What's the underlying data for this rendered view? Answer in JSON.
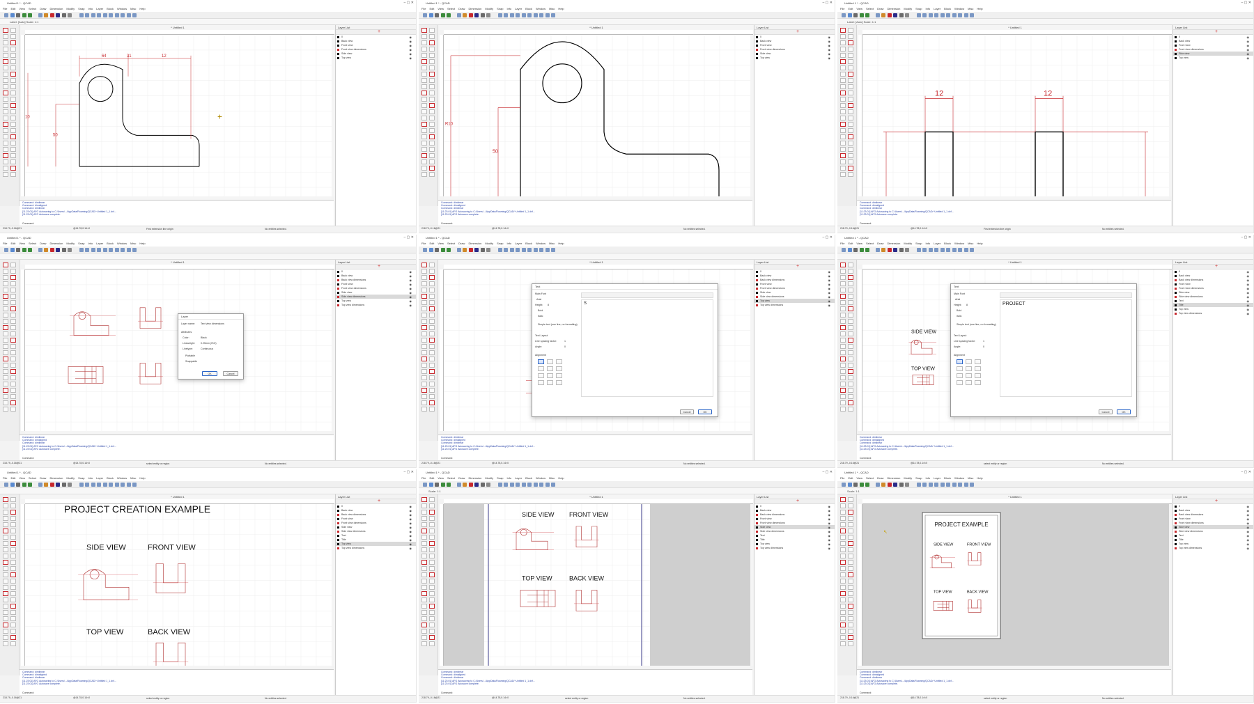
{
  "app_title": "Untitled 1 * - QCAD",
  "doc_tab": "* Untitled 1",
  "menu": [
    "File",
    "Edit",
    "View",
    "Select",
    "Draw",
    "Dimension",
    "Modify",
    "Snap",
    "Info",
    "Layer",
    "Block",
    "Window",
    "Misc",
    "Help"
  ],
  "layer_panel_title": "Layer List",
  "layers_a": [
    "0",
    "Back view",
    "Front view",
    "Front view dimensions",
    "Side view",
    "Top view"
  ],
  "layers_b": [
    "0",
    "Back view",
    "Back view dimensions",
    "Front view",
    "Front view dimensions",
    "Side view",
    "Side view dimensions",
    "Top view",
    "Top view dimensions"
  ],
  "layers_c": [
    "0",
    "Back view",
    "Back view dimensions",
    "Front view",
    "Front view dimensions",
    "Side view",
    "Side view dimensions",
    "Text",
    "Title",
    "Top view",
    "Top view dimensions"
  ],
  "cmd_log": [
    "Command: dimlinear",
    "Command: dimaligned",
    "Command: dimlinear",
    "[11:23:01] AFG Autosaving to C:/Users/.../AppData/Roaming/QCAD/~Untitled 1_1.dxf...",
    "[11:23:01] AFG Autosave complete."
  ],
  "cmd_prompt": "Command:",
  "status": {
    "coords_a": "218.79,-0.16@21",
    "coords_b": "@14.78,0.14<0",
    "prompt_dim": "First extension line origin",
    "cancel": "Cancel",
    "no_entities": "No entities selected.",
    "prompt_select": "select entity or region",
    "grid_info": "10 < 100"
  },
  "panel1": {
    "dim_top": [
      "64",
      "31",
      "12"
    ],
    "dim_left": "10",
    "dim_mid": "50",
    "optbar": "Label: [Auto]     Scale: 1:1"
  },
  "panel2": {
    "dim_vert": "50",
    "dim_vert2": "R10"
  },
  "panel3": {
    "dim_left": "12",
    "dim_right": "12"
  },
  "panel4_dialog": {
    "title": "Layer",
    "name_label": "Layer name:",
    "name_value": "Text view dimensions",
    "attrs": "Attributes",
    "color_label": "Color:",
    "color_value": "Black",
    "lineweight_label": "Lineweight:",
    "lineweight_value": "0.25mm (ISO)",
    "linetype_label": "Linetype:",
    "linetype_value": "Continuous",
    "chk1": "Plottable",
    "chk2": "Snappable",
    "ok": "OK",
    "cancel": "Cancel"
  },
  "text_dialog": {
    "title": "Text",
    "main_font": "Main Font",
    "font": "Arial",
    "height_label": "Height:",
    "height": "8",
    "bold": "Bold",
    "italic": "Italic",
    "simple_text": "Simple text (one line, no formatting)",
    "text_layout": "Text Layout",
    "line_spacing": "Line spacing factor:",
    "line_spacing_val": "1",
    "angle_label": "Angle:",
    "angle": "0",
    "alignment": "Alignment",
    "ok": "OK",
    "cancel": "Cancel",
    "typed_5": "S",
    "typed_6": "PROJECT"
  },
  "panel6": {
    "side": "SIDE VIEW",
    "top": "TOP VIEW"
  },
  "panel7": {
    "title": "PROJECT CREATION EXAMPLE",
    "side": "SIDE VIEW",
    "front": "FRONT VIEW",
    "top": "TOP VIEW",
    "back": "BACK VIEW"
  },
  "panel8": {
    "side": "SIDE VIEW",
    "front": "FRONT VIEW",
    "top": "TOP VIEW",
    "back": "BACK VIEW",
    "scale": "Scale: 1:1"
  },
  "panel9": {
    "title": "PROJECT EXAMPLE",
    "side": "SIDE VIEW",
    "front": "FRONT VIEW",
    "top": "TOP VIEW",
    "back": "BACK VIEW"
  },
  "colors": {
    "accent_red": "#c8282d",
    "toolbar_blue": "#2b65c8"
  }
}
